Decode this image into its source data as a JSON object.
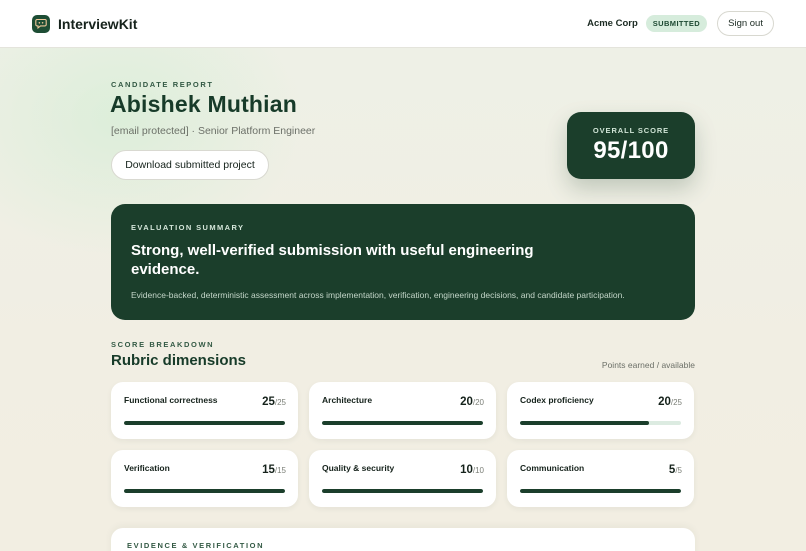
{
  "header": {
    "brand": "InterviewKit",
    "org": "Acme Corp",
    "status_badge": "SUBMITTED",
    "signout_label": "Sign out",
    "logo_icon": "chat-bubble-icon"
  },
  "candidate": {
    "eyebrow": "CANDIDATE REPORT",
    "name": "Abishek Muthian",
    "subtitle": "[email protected] · Senior Platform Engineer",
    "download_label": "Download submitted project"
  },
  "score": {
    "label": "OVERALL SCORE",
    "value": "95/100"
  },
  "summary": {
    "eyebrow": "EVALUATION SUMMARY",
    "title": "Strong, well-verified submission with useful engineering evidence.",
    "description": "Evidence-backed, deterministic assessment across implementation, verification, engineering decisions, and candidate participation."
  },
  "breakdown": {
    "eyebrow": "SCORE BREAKDOWN",
    "title": "Rubric dimensions",
    "hint": "Points earned / available",
    "dimensions": [
      {
        "label": "Functional correctness",
        "earned": "25",
        "available": "/25",
        "fraction": 1.0
      },
      {
        "label": "Architecture",
        "earned": "20",
        "available": "/20",
        "fraction": 1.0
      },
      {
        "label": "Codex proficiency",
        "earned": "20",
        "available": "/25",
        "fraction": 0.8
      },
      {
        "label": "Verification",
        "earned": "15",
        "available": "/15",
        "fraction": 1.0
      },
      {
        "label": "Quality & security",
        "earned": "10",
        "available": "/10",
        "fraction": 1.0
      },
      {
        "label": "Communication",
        "earned": "5",
        "available": "/5",
        "fraction": 1.0
      }
    ]
  },
  "evidence": {
    "eyebrow": "EVIDENCE & VERIFICATION"
  },
  "colors": {
    "accent": "#1b3e2b",
    "badge_bg": "#d6ecdc",
    "page_bg": "#f2efe4"
  }
}
